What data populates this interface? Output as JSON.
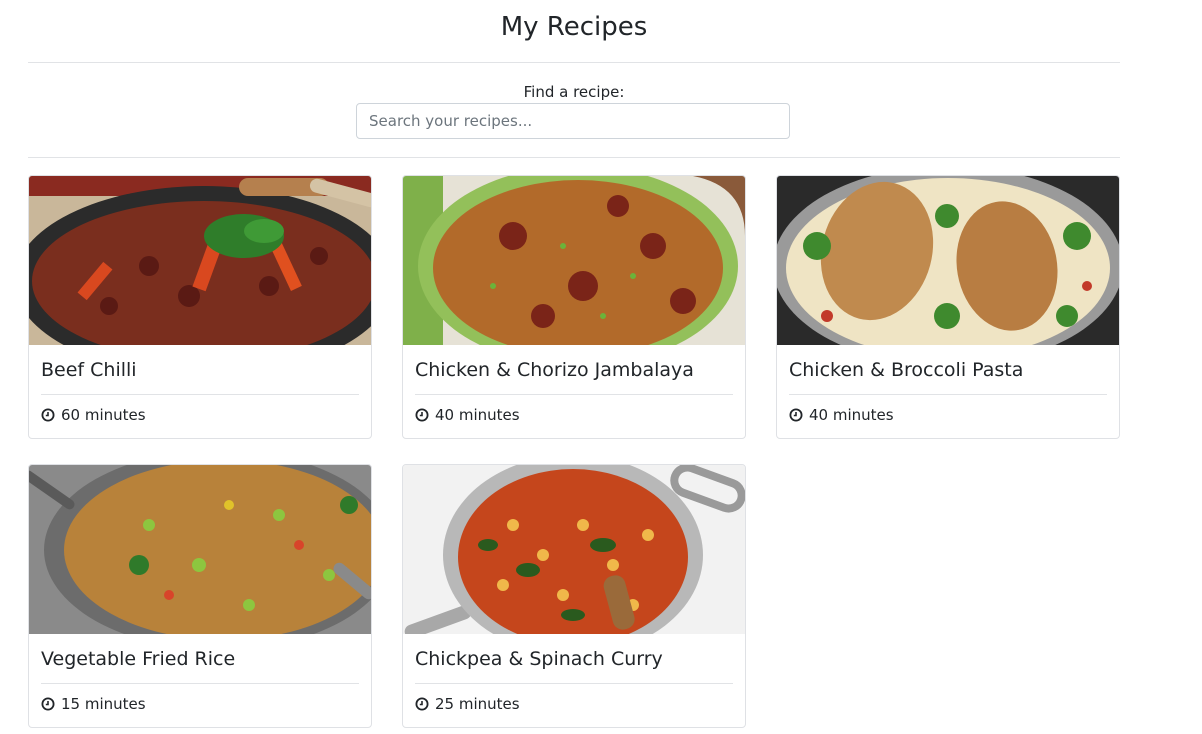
{
  "header": {
    "title": "My Recipes"
  },
  "search": {
    "label": "Find a recipe:",
    "placeholder": "Search your recipes..."
  },
  "recipes": [
    {
      "name": "Beef Chilli",
      "time": "60 minutes",
      "image": "beef-chilli-photo"
    },
    {
      "name": "Chicken & Chorizo Jambalaya",
      "time": "40 minutes",
      "image": "jambalaya-photo"
    },
    {
      "name": "Chicken & Broccoli Pasta",
      "time": "40 minutes",
      "image": "chicken-pasta-photo"
    },
    {
      "name": "Vegetable Fried Rice",
      "time": "15 minutes",
      "image": "fried-rice-photo"
    },
    {
      "name": "Chickpea & Spinach Curry",
      "time": "25 minutes",
      "image": "chickpea-curry-photo"
    }
  ],
  "icons": {
    "time": "clock-icon"
  }
}
